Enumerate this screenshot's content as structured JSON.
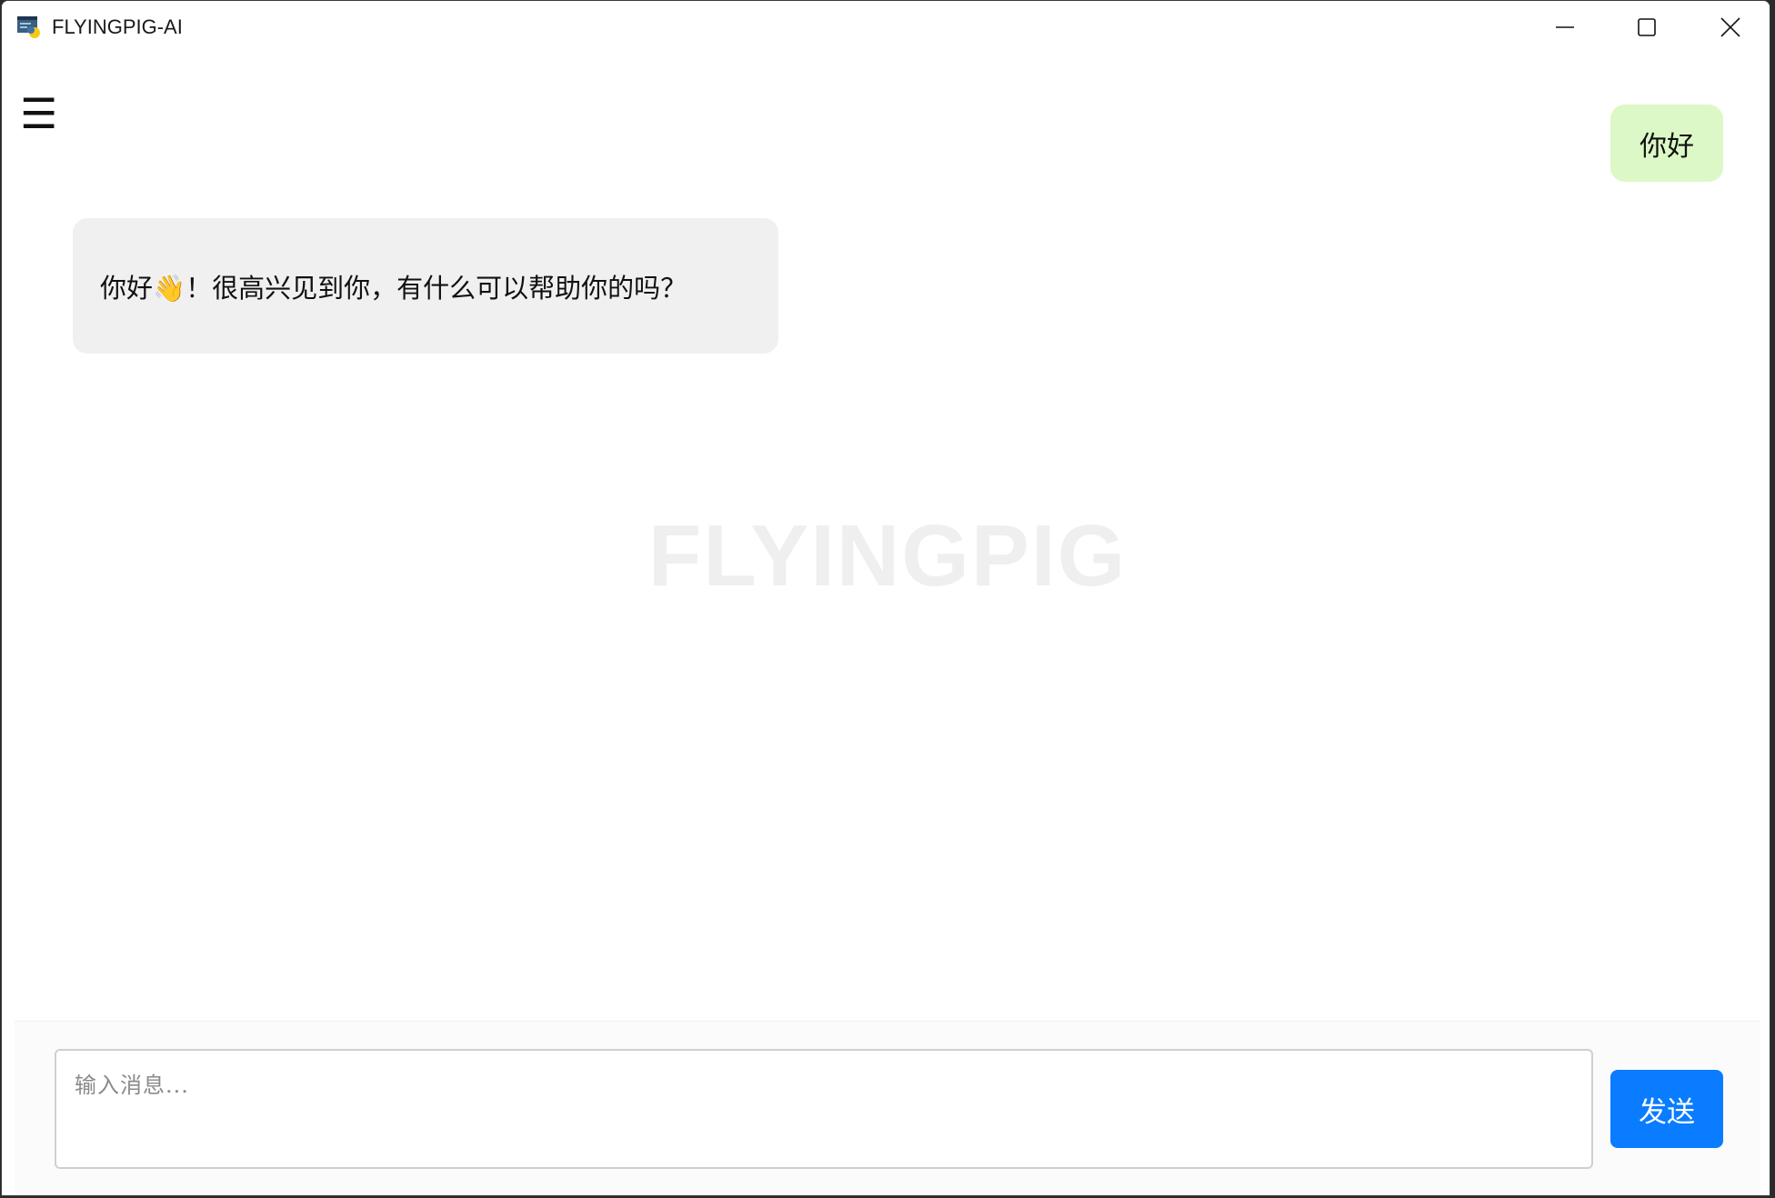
{
  "window": {
    "title": "FLYINGPIG-AI"
  },
  "icons": {
    "app": "python-app-icon",
    "minimize": "minimize-icon",
    "maximize": "maximize-icon",
    "close": "close-icon",
    "menu": "hamburger-menu-icon"
  },
  "menu": {
    "glyph": "☰"
  },
  "watermark": "FLYINGPIG",
  "messages": {
    "user": "你好",
    "bot": "你好👋！很高兴见到你，有什么可以帮助你的吗？"
  },
  "input": {
    "placeholder": "输入消息...",
    "value": ""
  },
  "send_label": "发送",
  "colors": {
    "user_bubble": "#dcf8c6",
    "bot_bubble": "#f0f0f0",
    "send_button": "#0a7cff",
    "watermark": "#efefef"
  }
}
